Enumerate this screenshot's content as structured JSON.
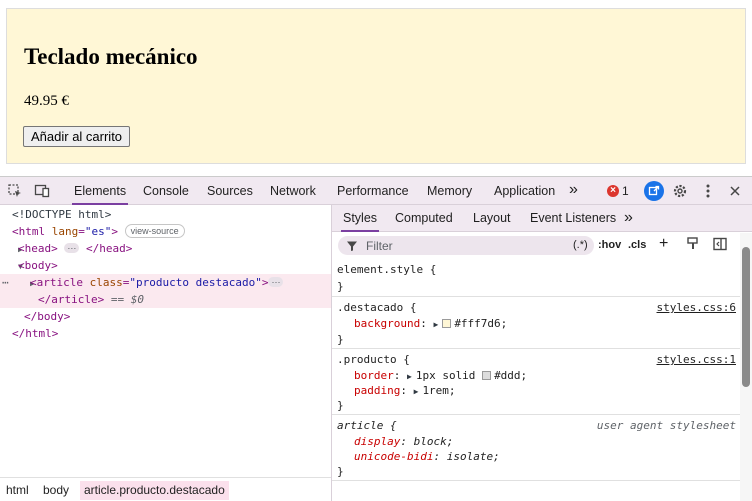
{
  "page": {
    "title": "Teclado mecánico",
    "price": "49.95 €",
    "button": "Añadir al carrito",
    "background": "#fff7d6",
    "border_color": "#dddddd"
  },
  "devtools": {
    "tabs": [
      "Elements",
      "Console",
      "Sources",
      "Network",
      "Performance",
      "Memory",
      "Application"
    ],
    "more_tabs": "»",
    "error_count": "1",
    "accent": "#7b3fa1",
    "icons": [
      "inspect-element-icon",
      "device-toolbar-icon",
      "sync-icon",
      "gear-icon",
      "kebab-menu-icon",
      "close-icon"
    ],
    "dom": {
      "doctype": "<!DOCTYPE html>",
      "html_open_tag": "<html",
      "html_attr": "lang",
      "html_attr_val": "\"es\"",
      "html_close_bracket": ">",
      "view_source": "view-source",
      "head_open": "<head>",
      "head_dots": "⋯",
      "head_close": "</head>",
      "body_open": "<body>",
      "article_open_tag": "<article",
      "article_attr": "class",
      "article_attr_val": "\"producto destacado\"",
      "article_close_bracket": ">",
      "article_dots": "⋯",
      "article_close": "</article>",
      "selected_marker": "== $0",
      "body_close": "</body>",
      "html_close": "</html>",
      "gutter_dots": "⋯"
    },
    "breadcrumbs": [
      "html",
      "body",
      "article.producto.destacado"
    ],
    "styles": {
      "sub_tabs": [
        "Styles",
        "Computed",
        "Layout",
        "Event Listeners"
      ],
      "filter_placeholder": "Filter",
      "filter_tools": [
        ".*",
        ":hov",
        ".cls"
      ],
      "rules": [
        {
          "selector": "element.style {",
          "source": "",
          "declarations": [],
          "close": "}"
        },
        {
          "selector": ".destacado {",
          "source": "styles.css:6",
          "declarations": [
            {
              "prop": "background",
              "value": "#fff7d6;",
              "swatch": "#fff7d6"
            }
          ],
          "close": "}"
        },
        {
          "selector": ".producto {",
          "source": "styles.css:1",
          "declarations": [
            {
              "prop": "border",
              "value": "1px solid",
              "value2": "#ddd;",
              "swatch": "#dddddd"
            },
            {
              "prop": "padding",
              "value": "1rem;"
            }
          ],
          "close": "}"
        },
        {
          "selector": "article {",
          "source": "user agent stylesheet",
          "declarations": [
            {
              "prop": "display",
              "value": "block;"
            },
            {
              "prop": "unicode-bidi",
              "value": "isolate;"
            }
          ],
          "close": "}"
        }
      ]
    }
  }
}
